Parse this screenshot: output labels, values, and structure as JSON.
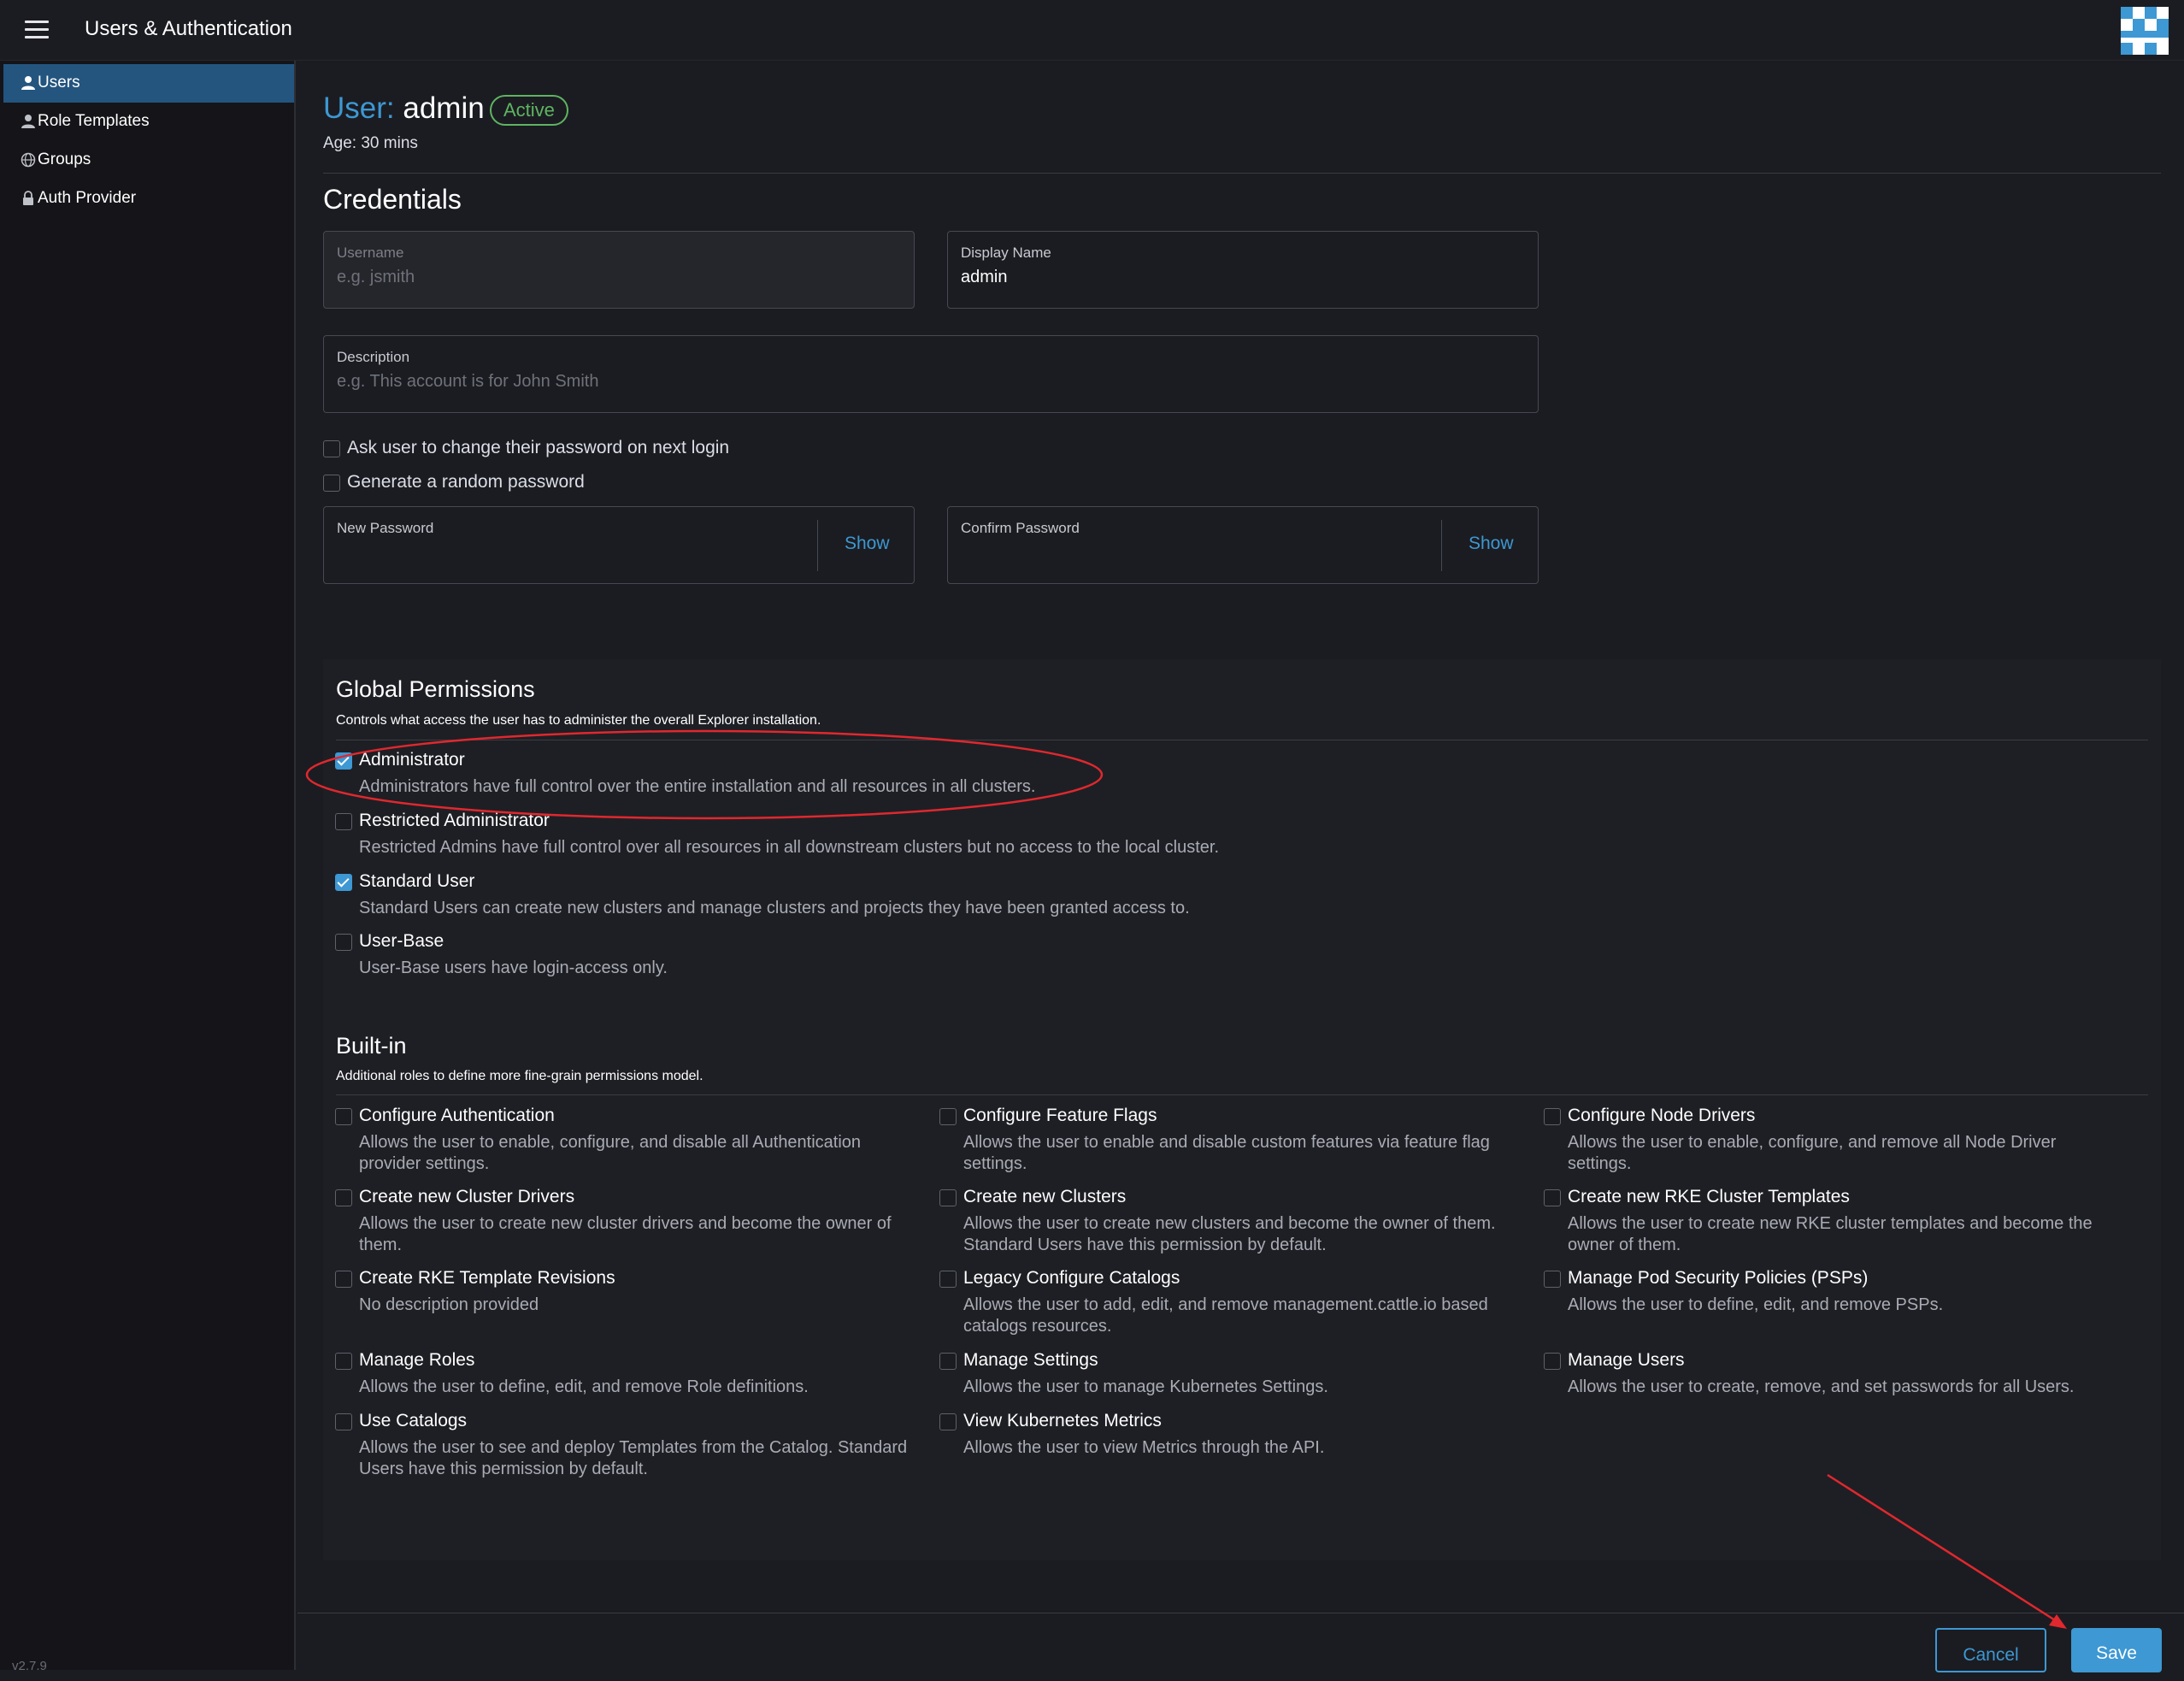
{
  "header": {
    "title": "Users & Authentication"
  },
  "sidebar": {
    "items": [
      {
        "label": "Users",
        "active": true,
        "icon": "user-icon"
      },
      {
        "label": "Role Templates",
        "active": false,
        "icon": "user-icon"
      },
      {
        "label": "Groups",
        "active": false,
        "icon": "globe-icon"
      },
      {
        "label": "Auth Provider",
        "active": false,
        "icon": "lock-icon"
      }
    ],
    "version": "v2.7.9"
  },
  "user": {
    "prefix": "User:",
    "name": "admin",
    "status": "Active",
    "age": "Age: 30 mins"
  },
  "credentials": {
    "title": "Credentials",
    "username": {
      "label": "Username",
      "value": "",
      "placeholder": "e.g. jsmith"
    },
    "display_name": {
      "label": "Display Name",
      "value": "admin"
    },
    "description": {
      "label": "Description",
      "value": "",
      "placeholder": "e.g. This account is for John Smith"
    },
    "ask_change": {
      "label": "Ask user to change their password on next login",
      "checked": false
    },
    "random_password": {
      "label": "Generate a random password",
      "checked": false
    },
    "new_password": {
      "label": "New Password",
      "show": "Show"
    },
    "confirm_password": {
      "label": "Confirm Password",
      "show": "Show"
    }
  },
  "global_permissions": {
    "title": "Global Permissions",
    "subtitle": "Controls what access the user has to administer the overall Explorer installation.",
    "roles": [
      {
        "name": "Administrator",
        "desc": "Administrators have full control over the entire installation and all resources in all clusters.",
        "checked": true
      },
      {
        "name": "Restricted Administrator",
        "desc": "Restricted Admins have full control over all resources in all downstream clusters but no access to the local cluster.",
        "checked": false
      },
      {
        "name": "Standard User",
        "desc": "Standard Users can create new clusters and manage clusters and projects they have been granted access to.",
        "checked": true
      },
      {
        "name": "User-Base",
        "desc": "User-Base users have login-access only.",
        "checked": false
      }
    ]
  },
  "builtin": {
    "title": "Built-in",
    "subtitle": "Additional roles to define more fine-grain permissions model.",
    "items": [
      {
        "name": "Configure Authentication",
        "desc1": "Allows the user to enable, configure, and disable all Authentication",
        "desc2": "provider settings.",
        "checked": false
      },
      {
        "name": "Configure Feature Flags",
        "desc1": "Allows the user to enable and disable custom features via feature flag",
        "desc2": "settings.",
        "checked": false
      },
      {
        "name": "Configure Node Drivers",
        "desc1": "Allows the user to enable, configure, and remove all Node Driver",
        "desc2": "settings.",
        "checked": false
      },
      {
        "name": "Create new Cluster Drivers",
        "desc1": "Allows the user to create new cluster drivers and become the owner of",
        "desc2": "them.",
        "checked": false
      },
      {
        "name": "Create new Clusters",
        "desc1": "Allows the user to create new clusters and become the owner of them.",
        "desc2": "Standard Users have this permission by default.",
        "checked": false
      },
      {
        "name": "Create new RKE Cluster Templates",
        "desc1": "Allows the user to create new RKE cluster templates and become the",
        "desc2": "owner of them.",
        "checked": false
      },
      {
        "name": "Create RKE Template Revisions",
        "desc1": "No description provided",
        "desc2": "",
        "checked": false
      },
      {
        "name": "Legacy Configure Catalogs",
        "desc1": "Allows the user to add, edit, and remove management.cattle.io based",
        "desc2": "catalogs resources.",
        "checked": false
      },
      {
        "name": "Manage Pod Security Policies (PSPs)",
        "desc1": "Allows the user to define, edit, and remove PSPs.",
        "desc2": "",
        "checked": false
      },
      {
        "name": "Manage Roles",
        "desc1": "Allows the user to define, edit, and remove Role definitions.",
        "desc2": "",
        "checked": false
      },
      {
        "name": "Manage Settings",
        "desc1": "Allows the user to manage Kubernetes Settings.",
        "desc2": "",
        "checked": false
      },
      {
        "name": "Manage Users",
        "desc1": "Allows the user to create, remove, and set passwords for all Users.",
        "desc2": "",
        "checked": false
      },
      {
        "name": "Use Catalogs",
        "desc1": "Allows the user to see and deploy Templates from the Catalog. Standard",
        "desc2": "Users have this permission by default.",
        "checked": false
      },
      {
        "name": "View Kubernetes Metrics",
        "desc1": "Allows the user to view Metrics through the API.",
        "desc2": "",
        "checked": false
      }
    ]
  },
  "actions": {
    "cancel": "Cancel",
    "save": "Save"
  },
  "colors": {
    "accent": "#3d98d3",
    "success": "#5fb462",
    "annotation": "#e0282e",
    "background": "#1b1c21"
  }
}
